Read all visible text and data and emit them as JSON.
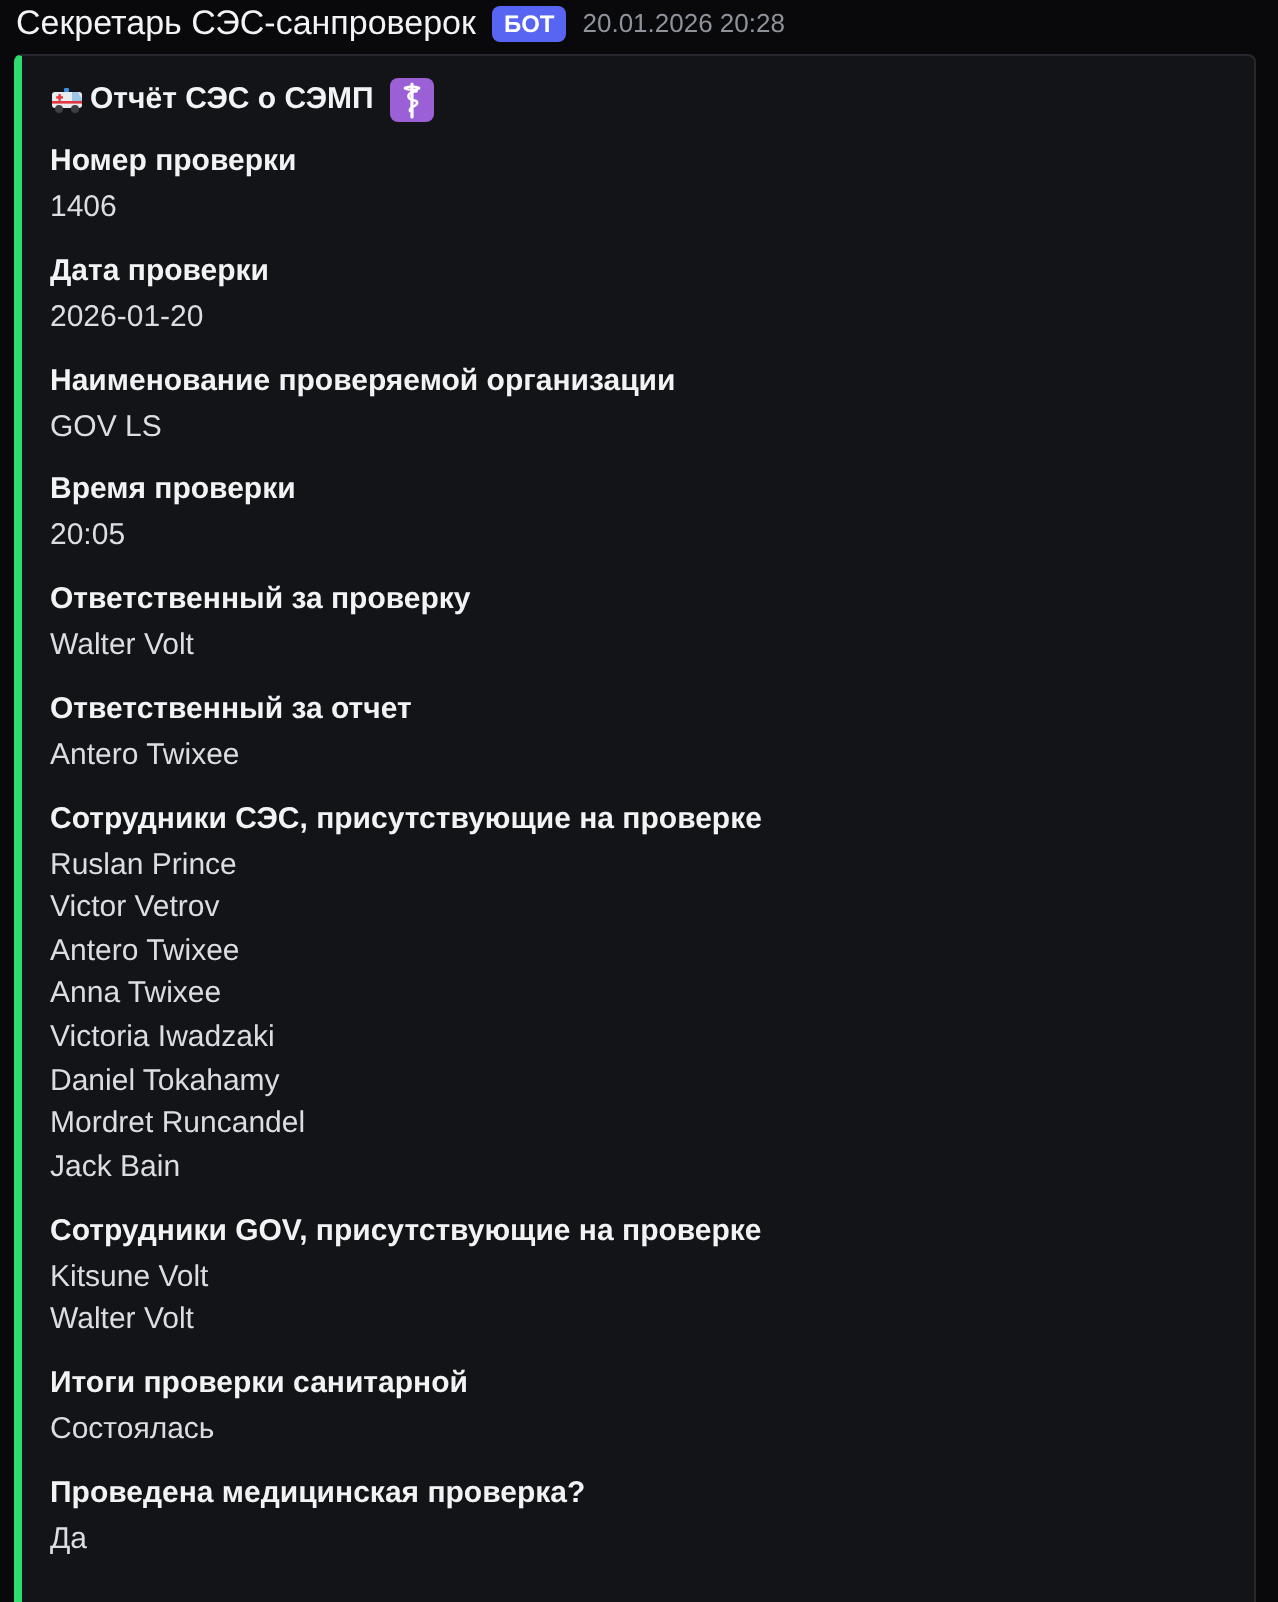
{
  "message": {
    "author": "Секретарь СЭС-санпроверок",
    "badge": "БОТ",
    "timestamp": "20.01.2026 20:28"
  },
  "embed": {
    "title": "Отчёт СЭС о СЭМП",
    "fields": [
      {
        "name": "Номер проверки",
        "values": [
          "1406"
        ]
      },
      {
        "name": "Дата проверки",
        "values": [
          "2026-01-20"
        ]
      },
      {
        "name": "Наименование проверяемой организации",
        "values": [
          "GOV LS"
        ]
      },
      {
        "name": "Время проверки",
        "values": [
          "20:05"
        ]
      },
      {
        "name": "Ответственный за проверку",
        "values": [
          "Walter Volt"
        ]
      },
      {
        "name": "Ответственный за отчет",
        "values": [
          "Antero Twixee"
        ]
      },
      {
        "name": "Сотрудники СЭС, присутствующие на проверке",
        "values": [
          "Ruslan Prince",
          "Victor Vetrov",
          "Antero Twixee",
          "Anna Twixee",
          "Victoria Iwadzaki",
          "Daniel Tokahamy",
          "Mordret Runcandel",
          "Jack Bain"
        ]
      },
      {
        "name": "Сотрудники GOV, присутствующие на проверке",
        "values": [
          "Kitsune Volt",
          "Walter Volt"
        ]
      },
      {
        "name": "Итоги проверки санитарной",
        "values": [
          "Состоялась"
        ]
      },
      {
        "name": "Проведена медицинская проверка?",
        "values": [
          "Да"
        ]
      }
    ]
  }
}
